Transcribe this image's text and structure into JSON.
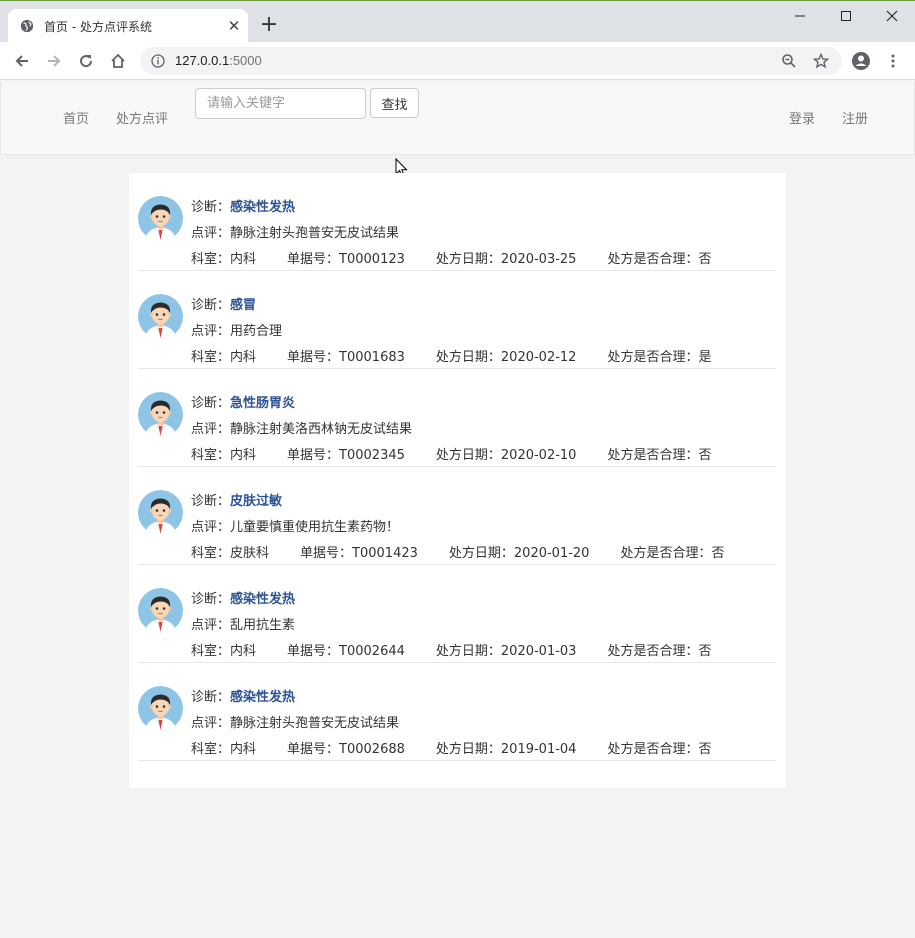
{
  "browser": {
    "tab_title": "首页 - 处方点评系统",
    "url_host": "127.0.0.1",
    "url_port": ":5000"
  },
  "navbar": {
    "home": "首页",
    "review": "处方点评",
    "search_placeholder": "请输入关键字",
    "search_button": "查找",
    "login": "登录",
    "register": "注册"
  },
  "labels": {
    "diagnosis": "诊断：",
    "comment": "点评：",
    "department": "科室：",
    "doc_no": "单据号：",
    "date": "处方日期：",
    "reasonable": "处方是否合理："
  },
  "records": [
    {
      "diagnosis": "感染性发热",
      "comment": "静脉注射头孢普安无皮试结果",
      "department": "内科",
      "doc_no": "T0000123",
      "date": "2020-03-25",
      "reasonable": "否"
    },
    {
      "diagnosis": "感冒",
      "comment": "用药合理",
      "department": "内科",
      "doc_no": "T0001683",
      "date": "2020-02-12",
      "reasonable": "是"
    },
    {
      "diagnosis": "急性肠胃炎",
      "comment": "静脉注射美洛西林钠无皮试结果",
      "department": "内科",
      "doc_no": "T0002345",
      "date": "2020-02-10",
      "reasonable": "否"
    },
    {
      "diagnosis": "皮肤过敏",
      "comment": "儿童要慎重使用抗生素药物！",
      "department": "皮肤科",
      "doc_no": "T0001423",
      "date": "2020-01-20",
      "reasonable": "否"
    },
    {
      "diagnosis": "感染性发热",
      "comment": "乱用抗生素",
      "department": "内科",
      "doc_no": "T0002644",
      "date": "2020-01-03",
      "reasonable": "否"
    },
    {
      "diagnosis": "感染性发热",
      "comment": "静脉注射头孢普安无皮试结果",
      "department": "内科",
      "doc_no": "T0002688",
      "date": "2019-01-04",
      "reasonable": "否"
    }
  ]
}
